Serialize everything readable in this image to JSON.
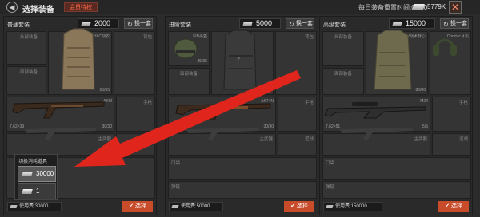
{
  "topbar": {
    "back_icon": "back-icon",
    "title": "选择装备",
    "vip_badge": "会员特权",
    "reset_text": "每日装备重置时间:05:00",
    "currency_amount": "5779K",
    "close_icon": "close-icon"
  },
  "panels": [
    {
      "name": "普通套装",
      "price": "2000",
      "swap_label": "换一套",
      "helmet_slot": "头部装备",
      "vest_name": "HLC战衣",
      "vest_durability": "55/55",
      "backpack_slot": "背包",
      "face_slot": "面部装备",
      "weapon_name": "AKM",
      "weapon_ammo": "7.62×39",
      "weapon_mag": "30/30",
      "sidearm_slot": "手枪",
      "secondary_slot": "主武器",
      "melee_slot": "近战",
      "cost_label": "使用费:30000",
      "select_label": "选择"
    },
    {
      "name": "进阶套装",
      "price": "5000",
      "swap_label": "换一套",
      "helmet_name": "FIB头盔",
      "helmet_durability": "35/35",
      "backpack_slot": "背包",
      "face_slot": "面部装备",
      "weapon_name": "AK74N",
      "weapon_ammo": "5.45×39",
      "weapon_mag": "30/30",
      "sidearm_slot": "手枪",
      "secondary_slot": "主武器",
      "melee_slot": "近战",
      "pocket_slot": "口袋",
      "ammo_slot": "弹链",
      "cost_label": "使用费:50000",
      "select_label": "选择"
    },
    {
      "name": "高级套装",
      "price": "15000",
      "swap_label": "换一套",
      "helmet_slot": "头部装备",
      "vest_name": "IMTV战术背心",
      "vest_durability": "80/80",
      "headset_name": "Comtac耳机",
      "face_slot": "面部装备",
      "weapon_name": "M24",
      "weapon_ammo": "7.62×51",
      "weapon_mag": "5/5",
      "sidearm_slot": "手枪",
      "secondary_slot": "主武器",
      "melee_slot": "近战",
      "pocket_slot": "口袋",
      "ammo_slot": "弹链",
      "cost_label": "使用费:150000",
      "select_label": "选择"
    }
  ],
  "popup": {
    "title": "切换消耗道具",
    "options": [
      "30000",
      "1"
    ]
  },
  "colors": {
    "accent": "#c84b2a",
    "arrow": "#e0261c"
  }
}
